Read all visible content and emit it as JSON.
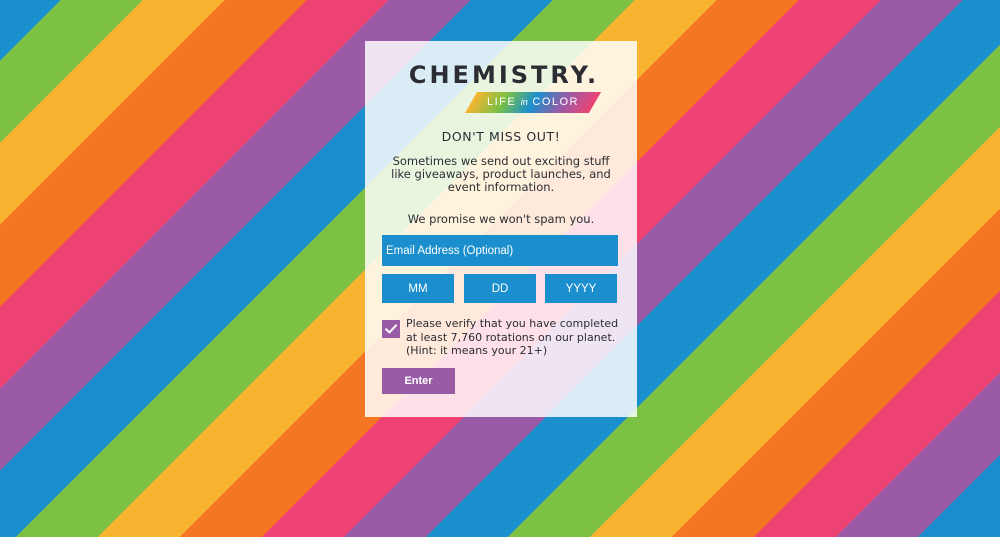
{
  "brand": {
    "name": "CHEMISTRY.",
    "tagline_pre": "LIFE",
    "tagline_in": "in",
    "tagline_post": "COLOR"
  },
  "modal": {
    "headline": "DON'T MISS OUT!",
    "description": "Sometimes we send out exciting stuff like giveaways, product launches, and event information.",
    "promise": "We promise we won't spam you."
  },
  "form": {
    "email_placeholder": "Email Address (Optional)",
    "month_placeholder": "MM",
    "day_placeholder": "DD",
    "year_placeholder": "YYYY",
    "verify_checked": true,
    "verify_text": "Please verify that you have completed at least 7,760 rotations on our planet. (Hint: it means your 21+)",
    "submit_label": "Enter"
  },
  "colors": {
    "stripes": [
      "#1b8fcd",
      "#9a5ba6",
      "#ee4372",
      "#f47622",
      "#f8b430",
      "#7cc143"
    ],
    "field_blue": "#1b8fcd",
    "button_purple": "#9a5ba6",
    "text_dark": "#2b2d33"
  },
  "icons": {
    "checkbox": "checkmark-icon"
  }
}
